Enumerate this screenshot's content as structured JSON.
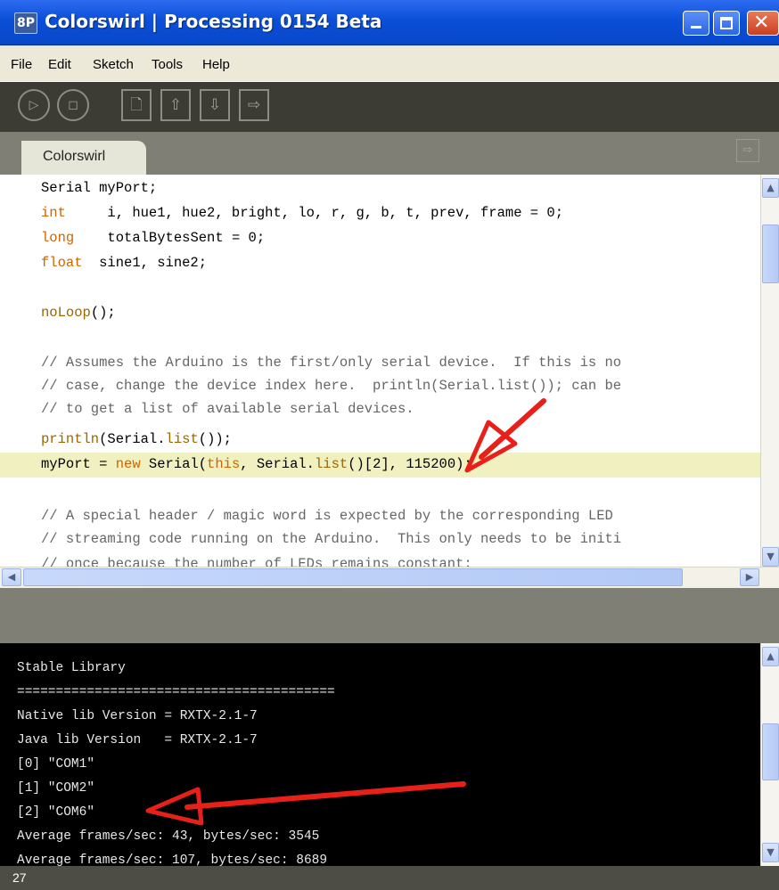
{
  "window": {
    "title": "Colorswirl | Processing 0154 Beta",
    "icon_text": "8P"
  },
  "menu": [
    "File",
    "Edit",
    "Sketch",
    "Tools",
    "Help"
  ],
  "toolbar": {
    "icons": [
      "run-icon",
      "stop-icon",
      "new-icon",
      "open-icon",
      "save-icon",
      "export-icon"
    ]
  },
  "tab": {
    "label": "Colorswirl"
  },
  "editor": {
    "highlight_line": 10,
    "lines": [
      "Serial myPort;",
      "int     i, hue1, hue2, bright, lo, r, g, b, t, prev, frame = 0;",
      "long    totalBytesSent = 0;",
      "float  sine1, sine2;",
      "",
      "noLoop();",
      "",
      "// Assumes the Arduino is the first/only serial device.  If this is no",
      "// case, change the device index here.  println(Serial.list()); can be",
      "// to get a list of available serial devices.",
      "println(Serial.list());",
      "myPort = new Serial(this, Serial.list()[2], 115200);",
      "",
      "// A special header / magic word is expected by the corresponding LED",
      "// streaming code running on the Arduino.  This only needs to be initi",
      "// once because the number of LEDs remains constant:"
    ]
  },
  "console": {
    "lines": [
      "Stable Library",
      "=========================================",
      "Native lib Version = RXTX-2.1-7",
      "Java lib Version   = RXTX-2.1-7",
      "[0] \"COM1\"",
      "[1] \"COM2\"",
      "[2] \"COM6\"",
      "Average frames/sec: 43, bytes/sec: 3545",
      "Average frames/sec: 107, bytes/sec: 8689"
    ]
  },
  "status": {
    "line_number": "27"
  },
  "annotations": {
    "arrow_color": "#e8201a"
  }
}
